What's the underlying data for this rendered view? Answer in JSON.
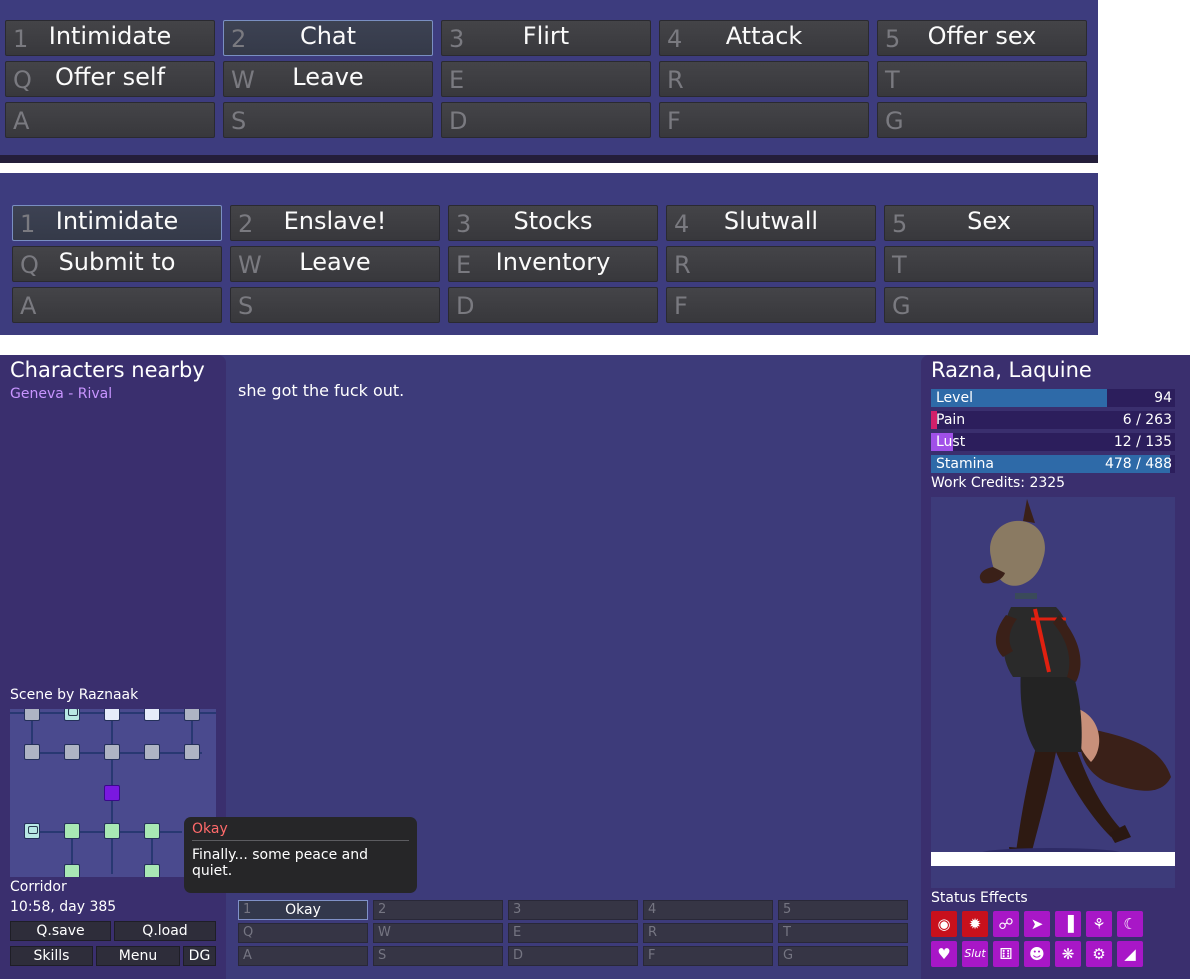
{
  "top_grid_1": {
    "buttons": [
      {
        "key": "1",
        "label": "Intimidate"
      },
      {
        "key": "2",
        "label": "Chat"
      },
      {
        "key": "3",
        "label": "Flirt"
      },
      {
        "key": "4",
        "label": "Attack"
      },
      {
        "key": "5",
        "label": "Offer sex"
      },
      {
        "key": "Q",
        "label": "Offer self"
      },
      {
        "key": "W",
        "label": "Leave"
      },
      {
        "key": "E",
        "label": ""
      },
      {
        "key": "R",
        "label": ""
      },
      {
        "key": "T",
        "label": ""
      },
      {
        "key": "A",
        "label": ""
      },
      {
        "key": "S",
        "label": ""
      },
      {
        "key": "D",
        "label": ""
      },
      {
        "key": "F",
        "label": ""
      },
      {
        "key": "G",
        "label": ""
      }
    ],
    "selected_index": 1
  },
  "top_grid_2": {
    "buttons": [
      {
        "key": "1",
        "label": "Intimidate"
      },
      {
        "key": "2",
        "label": "Enslave!"
      },
      {
        "key": "3",
        "label": "Stocks"
      },
      {
        "key": "4",
        "label": "Slutwall"
      },
      {
        "key": "5",
        "label": "Sex"
      },
      {
        "key": "Q",
        "label": "Submit to"
      },
      {
        "key": "W",
        "label": "Leave"
      },
      {
        "key": "E",
        "label": "Inventory"
      },
      {
        "key": "R",
        "label": ""
      },
      {
        "key": "T",
        "label": ""
      },
      {
        "key": "A",
        "label": ""
      },
      {
        "key": "S",
        "label": ""
      },
      {
        "key": "D",
        "label": ""
      },
      {
        "key": "F",
        "label": ""
      },
      {
        "key": "G",
        "label": ""
      }
    ],
    "selected_index": 0
  },
  "left": {
    "title": "Characters nearby",
    "nearby": "Geneva - Rival",
    "scene_by": "Scene by Raznaak",
    "location": "Corridor",
    "time": "10:58, day 385",
    "buttons": {
      "qsave": "Q.save",
      "qload": "Q.load",
      "skills": "Skills",
      "menu": "Menu",
      "dg": "DG"
    }
  },
  "center": {
    "message": "she got the fuck out.",
    "tooltip": {
      "title": "Okay",
      "body": "Finally... some peace and quiet."
    },
    "buttons": [
      {
        "key": "1",
        "label": "Okay"
      },
      {
        "key": "2",
        "label": ""
      },
      {
        "key": "3",
        "label": ""
      },
      {
        "key": "4",
        "label": ""
      },
      {
        "key": "5",
        "label": ""
      },
      {
        "key": "Q",
        "label": ""
      },
      {
        "key": "W",
        "label": ""
      },
      {
        "key": "E",
        "label": ""
      },
      {
        "key": "R",
        "label": ""
      },
      {
        "key": "T",
        "label": ""
      },
      {
        "key": "A",
        "label": ""
      },
      {
        "key": "S",
        "label": ""
      },
      {
        "key": "D",
        "label": ""
      },
      {
        "key": "F",
        "label": ""
      },
      {
        "key": "G",
        "label": ""
      }
    ],
    "selected_index": 0
  },
  "right": {
    "name": "Razna, Laquine",
    "stats": {
      "level": {
        "label": "Level",
        "value": "94",
        "fraction": 0.72,
        "color": "#2e6aa8"
      },
      "pain": {
        "label": "Pain",
        "value": "6 / 263",
        "fraction": 0.023,
        "color": "#d2206a"
      },
      "lust": {
        "label": "Lust",
        "value": "12 / 135",
        "fraction": 0.089,
        "color": "#a050e8"
      },
      "stamina": {
        "label": "Stamina",
        "value": "478 / 488",
        "fraction": 0.98,
        "color": "#2e6aa8"
      }
    },
    "credits": "Work Credits: 2325",
    "status_title": "Status Effects",
    "status_icons": [
      "mask-icon",
      "burst-icon",
      "chain-icon",
      "wing-icon",
      "bars-icon",
      "flower-icon",
      "moon-icon",
      "broken-heart-icon",
      "slut-icon",
      "dice-icon",
      "face-icon",
      "sparkle-icon",
      "gear-face-icon",
      "cone-icon"
    ],
    "slut_label": "Slut"
  }
}
